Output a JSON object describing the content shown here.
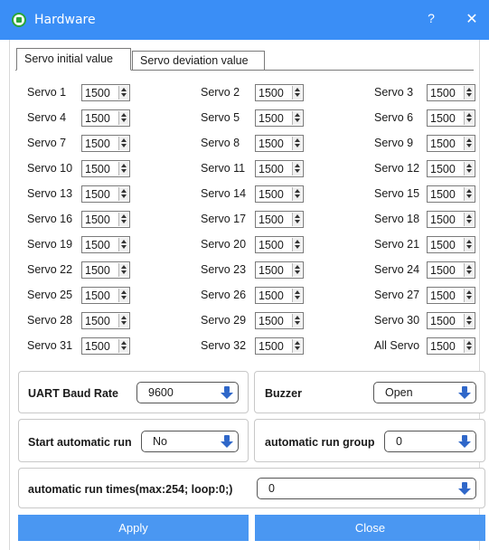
{
  "window": {
    "title": "Hardware",
    "help_label": "?",
    "close_label": "✕"
  },
  "tabs": [
    {
      "label": "Servo initial value",
      "active": true
    },
    {
      "label": "Servo deviation value",
      "active": false
    }
  ],
  "servos": [
    {
      "label": "Servo 1",
      "value": "1500"
    },
    {
      "label": "Servo 2",
      "value": "1500"
    },
    {
      "label": "Servo 3",
      "value": "1500"
    },
    {
      "label": "Servo 4",
      "value": "1500"
    },
    {
      "label": "Servo 5",
      "value": "1500"
    },
    {
      "label": "Servo 6",
      "value": "1500"
    },
    {
      "label": "Servo 7",
      "value": "1500"
    },
    {
      "label": "Servo 8",
      "value": "1500"
    },
    {
      "label": "Servo 9",
      "value": "1500"
    },
    {
      "label": "Servo 10",
      "value": "1500"
    },
    {
      "label": "Servo 11",
      "value": "1500"
    },
    {
      "label": "Servo 12",
      "value": "1500"
    },
    {
      "label": "Servo 13",
      "value": "1500"
    },
    {
      "label": "Servo 14",
      "value": "1500"
    },
    {
      "label": "Servo 15",
      "value": "1500"
    },
    {
      "label": "Servo 16",
      "value": "1500"
    },
    {
      "label": "Servo 17",
      "value": "1500"
    },
    {
      "label": "Servo 18",
      "value": "1500"
    },
    {
      "label": "Servo 19",
      "value": "1500"
    },
    {
      "label": "Servo 20",
      "value": "1500"
    },
    {
      "label": "Servo 21",
      "value": "1500"
    },
    {
      "label": "Servo 22",
      "value": "1500"
    },
    {
      "label": "Servo 23",
      "value": "1500"
    },
    {
      "label": "Servo 24",
      "value": "1500"
    },
    {
      "label": "Servo 25",
      "value": "1500"
    },
    {
      "label": "Servo 26",
      "value": "1500"
    },
    {
      "label": "Servo 27",
      "value": "1500"
    },
    {
      "label": "Servo 28",
      "value": "1500"
    },
    {
      "label": "Servo 29",
      "value": "1500"
    },
    {
      "label": "Servo 30",
      "value": "1500"
    },
    {
      "label": "Servo 31",
      "value": "1500"
    },
    {
      "label": "Servo 32",
      "value": "1500"
    },
    {
      "label": "All Servo",
      "value": "1500"
    }
  ],
  "settings": {
    "uart": {
      "label": "UART Baud Rate",
      "value": "9600"
    },
    "buzzer": {
      "label": "Buzzer",
      "value": "Open"
    },
    "auto_run": {
      "label": "Start automatic run",
      "value": "No"
    },
    "auto_group": {
      "label": "automatic run group",
      "value": "0"
    },
    "auto_times": {
      "label": "automatic run times(max:254; loop:0;)",
      "value": "0"
    }
  },
  "buttons": {
    "apply": "Apply",
    "close": "Close"
  },
  "colors": {
    "titlebar": "#3a8ef6",
    "button": "#4a97f2",
    "combo_arrow": "#2f67c9"
  }
}
